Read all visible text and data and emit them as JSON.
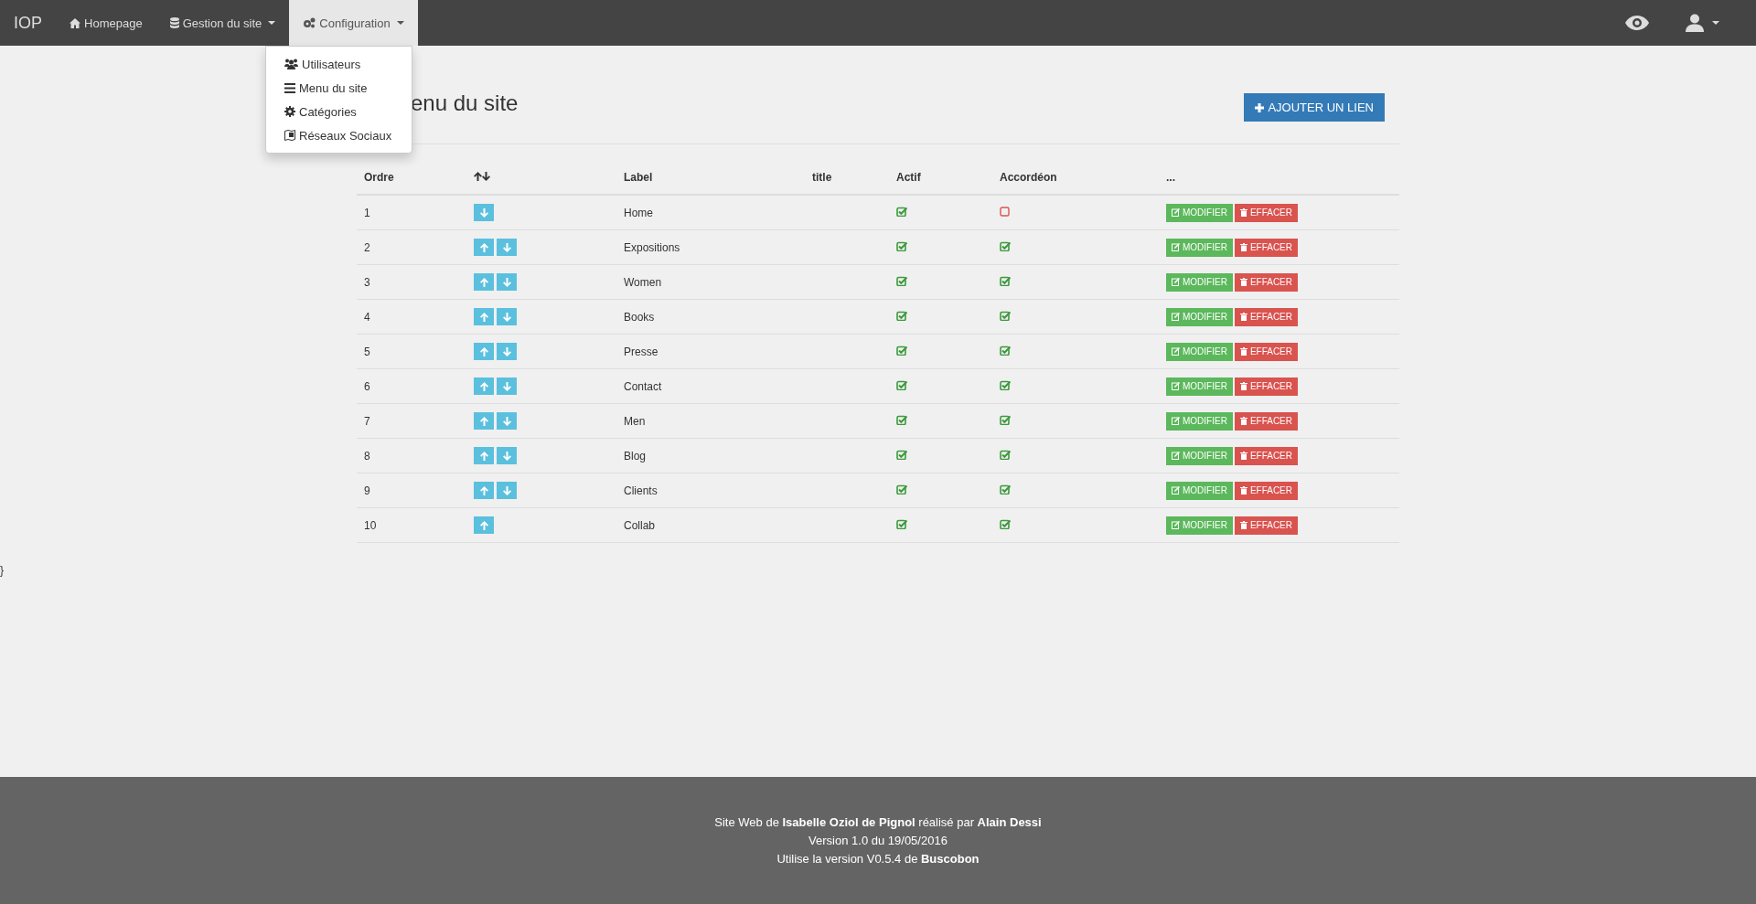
{
  "navbar": {
    "brand": "IOP",
    "items": [
      {
        "kind": "link",
        "label": "Homepage",
        "selected": false
      },
      {
        "kind": "dropdown",
        "label": "Gestion du site",
        "selected": false
      },
      {
        "kind": "dropdown",
        "label": "Configuration",
        "selected": true
      }
    ]
  },
  "dropdown_menu": {
    "items": [
      {
        "label": "Utilisateurs"
      },
      {
        "label": "Menu du site"
      },
      {
        "label": "Catégories"
      },
      {
        "label": "Réseaux Sociaux"
      }
    ]
  },
  "page": {
    "title": "enu du site",
    "add_button": "AJOUTER UN LIEN"
  },
  "table": {
    "columns": [
      "Ordre",
      "Label",
      "title",
      "Actif",
      "Accordéon",
      "..."
    ],
    "rows": [
      {
        "order": "1",
        "label": "Home",
        "move_up": false,
        "move_down": true,
        "actif": true,
        "accordeon": false,
        "edit_button": "MODIFIER",
        "delete_button": "EFFACER"
      },
      {
        "order": "2",
        "label": "Expositions",
        "move_up": true,
        "move_down": true,
        "actif": true,
        "accordeon": true,
        "edit_button": "MODIFIER",
        "delete_button": "EFFACER"
      },
      {
        "order": "3",
        "label": "Women",
        "move_up": true,
        "move_down": true,
        "actif": true,
        "accordeon": true,
        "edit_button": "MODIFIER",
        "delete_button": "EFFACER"
      },
      {
        "order": "4",
        "label": "Books",
        "move_up": true,
        "move_down": true,
        "actif": true,
        "accordeon": true,
        "edit_button": "MODIFIER",
        "delete_button": "EFFACER"
      },
      {
        "order": "5",
        "label": "Presse",
        "move_up": true,
        "move_down": true,
        "actif": true,
        "accordeon": true,
        "edit_button": "MODIFIER",
        "delete_button": "EFFACER"
      },
      {
        "order": "6",
        "label": "Contact",
        "move_up": true,
        "move_down": true,
        "actif": true,
        "accordeon": true,
        "edit_button": "MODIFIER",
        "delete_button": "EFFACER"
      },
      {
        "order": "7",
        "label": "Men",
        "move_up": true,
        "move_down": true,
        "actif": true,
        "accordeon": true,
        "edit_button": "MODIFIER",
        "delete_button": "EFFACER"
      },
      {
        "order": "8",
        "label": "Blog",
        "move_up": true,
        "move_down": true,
        "actif": true,
        "accordeon": true,
        "edit_button": "MODIFIER",
        "delete_button": "EFFACER"
      },
      {
        "order": "9",
        "label": "Clients",
        "move_up": true,
        "move_down": true,
        "actif": true,
        "accordeon": true,
        "edit_button": "MODIFIER",
        "delete_button": "EFFACER"
      },
      {
        "order": "10",
        "label": "Collab",
        "move_up": true,
        "move_down": false,
        "actif": true,
        "accordeon": true,
        "edit_button": "MODIFIER",
        "delete_button": "EFFACER"
      }
    ]
  },
  "stray_text": "}",
  "footer": {
    "lines": [
      "Site Web de **Isabelle Oziol de Pignol** réalisé par **Alain Dessi**",
      "Version 1.0 du 19/05/2016",
      "Utilise la version V0.5.4 de **Buscobon**"
    ]
  }
}
